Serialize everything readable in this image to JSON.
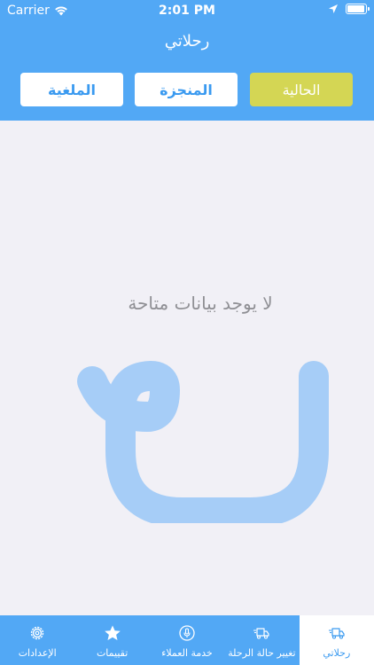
{
  "status": {
    "carrier": "Carrier",
    "time": "2:01 PM"
  },
  "header": {
    "title": "رحلاتي"
  },
  "tabs": [
    {
      "label": "الحالية",
      "active": true
    },
    {
      "label": "المنجزة",
      "active": false
    },
    {
      "label": "الملغية",
      "active": false
    }
  ],
  "empty_state": {
    "message": "لا يوجد بيانات متاحة"
  },
  "tabbar": [
    {
      "label": "رحلاتي",
      "icon": "truck-icon",
      "selected": true
    },
    {
      "label": "تغيير حالة الرحلة",
      "icon": "truck-icon",
      "selected": false
    },
    {
      "label": "خدمة العملاء",
      "icon": "support-icon",
      "selected": false
    },
    {
      "label": "تقييمات",
      "icon": "star-icon",
      "selected": false
    },
    {
      "label": "الإعدادات",
      "icon": "gear-icon",
      "selected": false
    }
  ],
  "colors": {
    "primary": "#52a8f5",
    "active_tab": "#d4d654",
    "logo": "#a6cdf7",
    "background": "#f1f0f6"
  }
}
